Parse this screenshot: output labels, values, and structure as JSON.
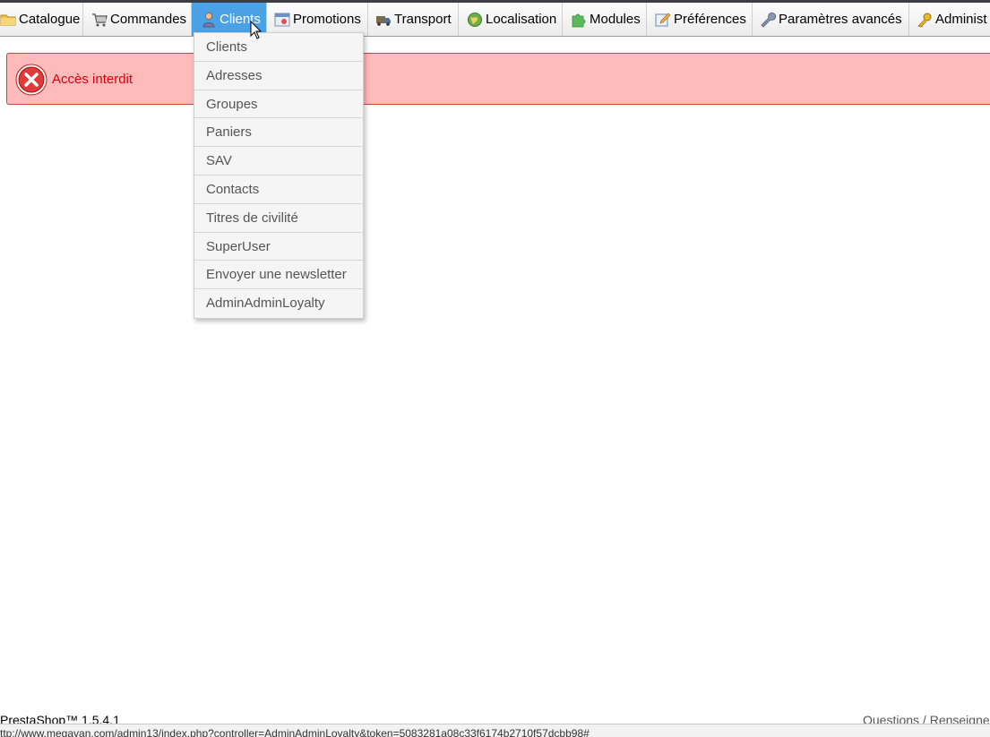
{
  "nav": {
    "items": [
      {
        "label": "Catalogue",
        "icon": "folder-icon"
      },
      {
        "label": "Commandes",
        "icon": "cart-icon"
      },
      {
        "label": "Clients",
        "icon": "user-icon"
      },
      {
        "label": "Promotions",
        "icon": "promotion-icon"
      },
      {
        "label": "Transport",
        "icon": "truck-icon"
      },
      {
        "label": "Localisation",
        "icon": "globe-icon"
      },
      {
        "label": "Modules",
        "icon": "puzzle-icon"
      },
      {
        "label": "Préférences",
        "icon": "edit-icon"
      },
      {
        "label": "Paramètres avancés",
        "icon": "wrench-icon"
      },
      {
        "label": "Administ",
        "icon": "key-icon"
      }
    ],
    "active_label": "Clients"
  },
  "dropdown": {
    "items": [
      "Clients",
      "Adresses",
      "Groupes",
      "Paniers",
      "SAV",
      "Contacts",
      "Titres de civilité",
      "SuperUser",
      "Envoyer une newsletter",
      "AdminAdminLoyalty"
    ]
  },
  "alert": {
    "text": "Accès interdit",
    "icon": "error-icon",
    "color": "#d8000c",
    "background": "#ffbaba"
  },
  "footer": {
    "version": "PrestaShop™ 1.5.4.1",
    "right_link": "Questions / Renseignem"
  },
  "statusbar": {
    "url": "ttp://www.megavan.com/admin13/index.php?controller=AdminAdminLoyalty&token=5083281a08c33f6174b2710f57dcbb98#"
  },
  "colors": {
    "accent": "#4aa1e6",
    "nav_bg": "#f4f4f4"
  }
}
